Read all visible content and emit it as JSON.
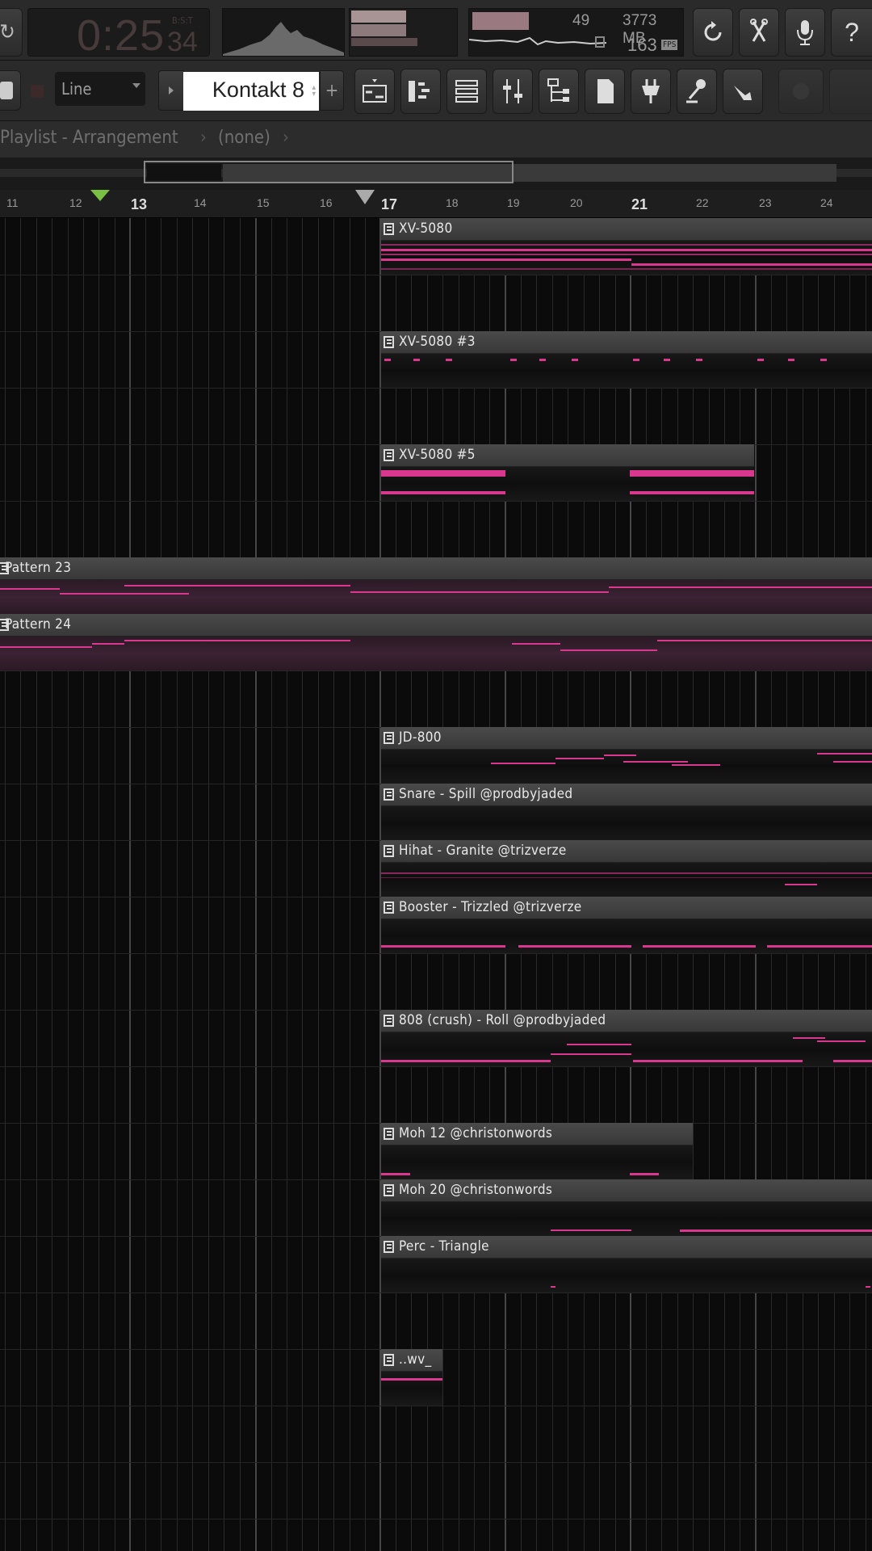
{
  "transport": {
    "time_main": "0:25",
    "time_sub": "34",
    "time_sub_label": "B:S:T"
  },
  "performance": {
    "polyphony": "49",
    "memory": "3773 MB",
    "cpu_value": "163",
    "cpu_label": "FPS"
  },
  "toolbar": {
    "snap_mode": "Line",
    "channel_name": "Kontakt 8",
    "add_symbol": "+"
  },
  "playlist": {
    "title": "Playlist - Arrangement",
    "pattern": "(none)",
    "bar_numbers": [
      "11",
      "12",
      "13",
      "14",
      "15",
      "16",
      "17",
      "18",
      "19",
      "20",
      "21",
      "22",
      "23",
      "24"
    ],
    "clips": [
      {
        "name": "XV-5080"
      },
      {
        "name": "XV-5080 #3"
      },
      {
        "name": "XV-5080 #5"
      },
      {
        "name": "Pattern 23"
      },
      {
        "name": "Pattern 24"
      },
      {
        "name": "JD-800"
      },
      {
        "name": "Snare - Spill @prodbyjaded"
      },
      {
        "name": "Hihat - Granite @trizverze"
      },
      {
        "name": "Booster - Trizzled @trizverze"
      },
      {
        "name": "808 (crush) - Roll @prodbyjaded"
      },
      {
        "name": "Moh 12 @christonwords"
      },
      {
        "name": "Moh 20 @christonwords"
      },
      {
        "name": "Perc - Triangle"
      },
      {
        "name": "..wv_"
      }
    ]
  },
  "icons": [
    "refresh-icon",
    "scissors-icon",
    "microphone-icon",
    "help-icon",
    "piano-roll-icon",
    "channel-rack-icon",
    "mixer-icon",
    "browser-icon",
    "plugin-icon",
    "pin-icon"
  ],
  "colors": {
    "note": "#d8398f",
    "accent": "#ff4fa8"
  }
}
